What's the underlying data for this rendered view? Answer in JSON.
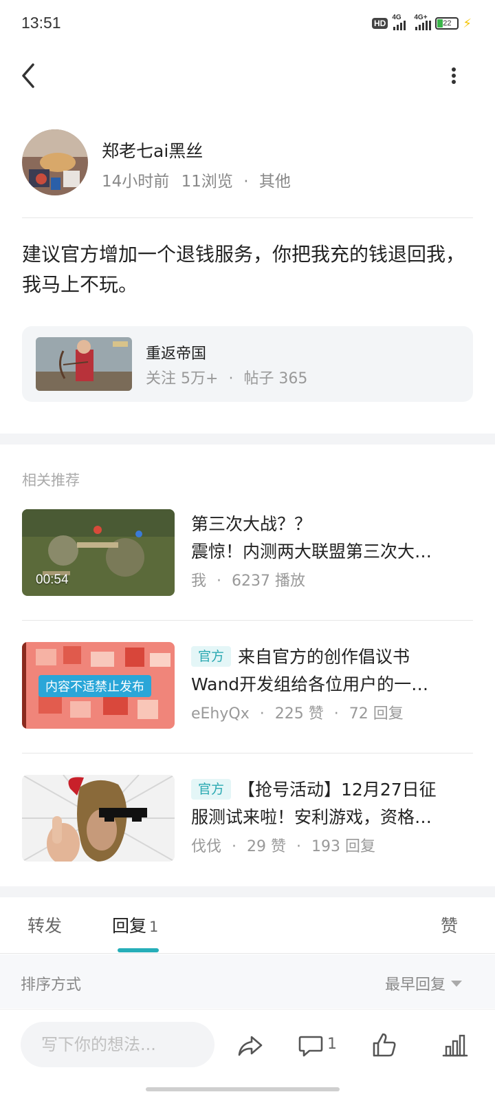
{
  "status_bar": {
    "time": "13:51",
    "hd_label": "HD",
    "network_1": "4G",
    "network_2": "4G+",
    "battery": "22"
  },
  "author": {
    "name": "郑老七ai黑丝",
    "time_ago": "14小时前",
    "views": "11浏览",
    "category": "其他"
  },
  "post": {
    "body": "建议官方增加一个退钱服务，你把我充的钱退回我，我马上不玩。"
  },
  "game_card": {
    "name": "重返帝国",
    "followers": "关注 5万+",
    "posts": "帖子 365"
  },
  "recommendations": {
    "title": "相关推荐",
    "items": [
      {
        "line1": "第三次大战？？",
        "line2": "震惊！内测两大联盟第三次大…",
        "author": "我",
        "stat1": "6237 播放",
        "stat2": "",
        "duration": "00:54",
        "tag": ""
      },
      {
        "tag": "官方",
        "line1": "来自官方的创作倡议书",
        "line2": "Wand开发组给各位用户的一…",
        "author": "eEhyQx",
        "stat1": "225 赞",
        "stat2": "72 回复",
        "banned_label": "内容不适禁止发布"
      },
      {
        "tag": "官方",
        "line1": "【抢号活动】12月27日征",
        "line2": "服测试来啦！安利游戏，资格…",
        "author": "伐伐",
        "stat1": "29 赞",
        "stat2": "193 回复"
      }
    ]
  },
  "tabs": {
    "forward": "转发",
    "reply": "回复",
    "reply_count": "1",
    "like": "赞"
  },
  "sort": {
    "label": "排序方式",
    "value": "最早回复"
  },
  "bottom_bar": {
    "input_placeholder": "写下你的想法...",
    "comment_count": "1"
  },
  "colors": {
    "accent": "#26aeb8",
    "official_tag_bg": "#e4f6f7",
    "official_tag_text": "#2ba9b2"
  }
}
